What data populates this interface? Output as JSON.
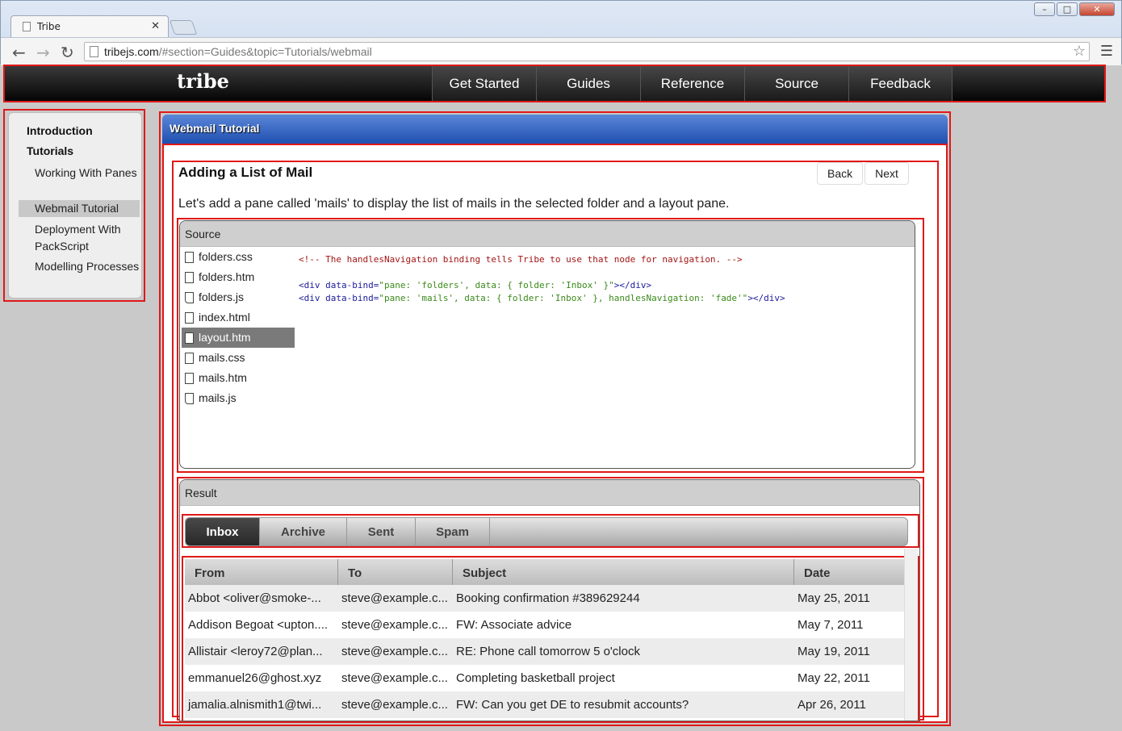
{
  "browser": {
    "tab_title": "Tribe",
    "url_host": "tribejs.com",
    "url_path": "/#section=Guides&topic=Tutorials/webmail"
  },
  "site": {
    "logo": "tribe",
    "nav": [
      "Get Started",
      "Guides",
      "Reference",
      "Source",
      "Feedback"
    ]
  },
  "sidebar": {
    "heading_intro": "Introduction",
    "heading_tutorials": "Tutorials",
    "items": [
      {
        "label": "Working With Panes"
      },
      {
        "label": "Webmail Tutorial",
        "active": true
      },
      {
        "label": "Deployment With PackScript"
      },
      {
        "label": "Modelling Processes"
      }
    ]
  },
  "panel": {
    "title": "Webmail Tutorial",
    "lesson_title": "Adding a List of Mail",
    "back_label": "Back",
    "next_label": "Next",
    "description": "Let's add a pane called 'mails' to display the list of mails in the selected folder and a layout pane."
  },
  "source": {
    "label": "Source",
    "files": [
      {
        "name": "folders.css",
        "kind": "css"
      },
      {
        "name": "folders.htm",
        "kind": "htm"
      },
      {
        "name": "folders.js",
        "kind": "js"
      },
      {
        "name": "index.html",
        "kind": "htm"
      },
      {
        "name": "layout.htm",
        "kind": "htm",
        "selected": true
      },
      {
        "name": "mails.css",
        "kind": "css"
      },
      {
        "name": "mails.htm",
        "kind": "htm"
      },
      {
        "name": "mails.js",
        "kind": "js"
      }
    ],
    "code_comment": "<!-- The handlesNavigation binding tells Tribe to use that node for navigation. -->",
    "code_line1_open": "<div data-bind=",
    "code_line1_value": "\"pane: 'folders', data: { folder: 'Inbox' }\"",
    "code_line1_close": "></div>",
    "code_line2_open": "<div data-bind=",
    "code_line2_value": "\"pane: 'mails', data: { folder: 'Inbox' }, handlesNavigation: 'fade'\"",
    "code_line2_close": "></div>"
  },
  "result": {
    "label": "Result",
    "tabs": [
      {
        "label": "Inbox",
        "active": true
      },
      {
        "label": "Archive"
      },
      {
        "label": "Sent"
      },
      {
        "label": "Spam"
      }
    ],
    "columns": [
      "From",
      "To",
      "Subject",
      "Date"
    ],
    "rows": [
      {
        "from": "Abbot <oliver@smoke-...",
        "to": "steve@example.c...",
        "subject": "Booking confirmation #389629244",
        "date": "May 25, 2011"
      },
      {
        "from": "Addison Begoat <upton....",
        "to": "steve@example.c...",
        "subject": "FW: Associate advice",
        "date": "May 7, 2011"
      },
      {
        "from": "Allistair <leroy72@plan...",
        "to": "steve@example.c...",
        "subject": "RE: Phone call tomorrow 5 o'clock",
        "date": "May 19, 2011"
      },
      {
        "from": "emmanuel26@ghost.xyz",
        "to": "steve@example.c...",
        "subject": "Completing basketball project",
        "date": "May 22, 2011"
      },
      {
        "from": "jamalia.alnismith1@twi...",
        "to": "steve@example.c...",
        "subject": "FW: Can you get DE to resubmit accounts?",
        "date": "Apr 26, 2011"
      }
    ]
  }
}
